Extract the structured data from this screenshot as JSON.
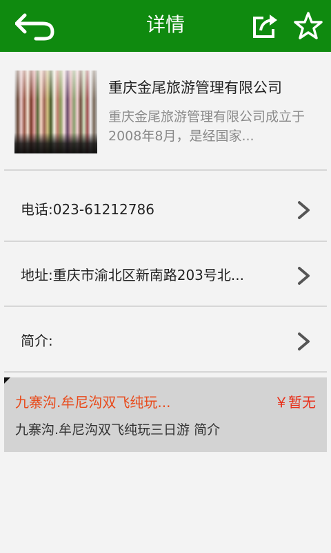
{
  "header": {
    "title": "详情",
    "back_icon": "back-arrow-icon",
    "share_icon": "share-icon",
    "favorite_icon": "star-icon",
    "background": "#0f8a0f"
  },
  "company": {
    "name": "重庆金尾旅游管理有限公司",
    "description": "重庆金尾旅游管理有限公司成立于2008年8月，是经国家..."
  },
  "info_rows": [
    {
      "label": "电话:023-61212786"
    },
    {
      "label": "地址:重庆市渝北区新南路203号北..."
    },
    {
      "label": "简介:"
    }
  ],
  "tour": {
    "name": "九寨沟.牟尼沟双飞纯玩...",
    "price": "￥暂无",
    "intro": "九寨沟.牟尼沟双飞纯玩三日游 简介",
    "name_color": "#e84b1c",
    "price_color": "#e8321c"
  }
}
